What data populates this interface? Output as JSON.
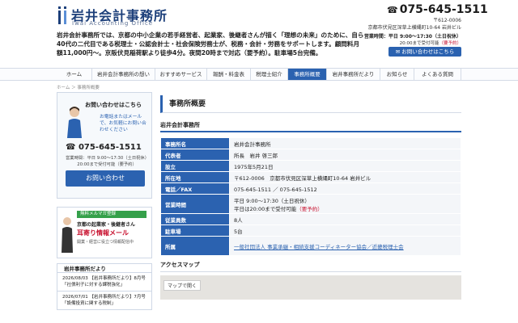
{
  "header": {
    "logo_title": "岩井会計事務所",
    "logo_sub": "Iwai Accounting Office",
    "intro": "岩井会計事務所では、京都の中小企業の若手経営者、起業家、後継者さんが描く「理想の未来」のために、自ら40代の二代目である税理士・公認会計士・社会保険労務士が、税務・会計・労務をサポートします。顧問料月額11,000円～。京阪伏見稲荷駅より徒歩4分。夜間20時まで対応（要予約）。駐車場5台完備。",
    "phone": "075-645-1511",
    "addr1": "〒612-0006",
    "addr2": "京都市伏見区深草上横縄町10-64 岩井ビル",
    "hours": "営業時間：平日 9:00～17:30（土日祝休）",
    "hours_note": "20:00まで受付可能",
    "hours_req": "（要予約）",
    "contact_btn": "お問い合わせはこちら"
  },
  "nav": [
    "ホーム",
    "岩井会計事務所の想い",
    "おすすめサービス",
    "報酬・料金表",
    "税理士紹介",
    "事務所概要",
    "岩井事務所だより",
    "お知らせ",
    "よくある質問"
  ],
  "breadcrumb": "ホーム ＞ 事務所概要",
  "sidebar": {
    "contact_title": "お問い合わせはこちら",
    "contact_note": "お電話またはメールで、お気軽にお問い合わせください",
    "phone": "075-645-1511",
    "hours": "営業時間：平日 9:00～17:30（土日祝休）",
    "hours_note": "20:00まで受付可能（要予約）",
    "button": "お問い合わせ",
    "mail_head": "無料メルマガ登録",
    "mail_l1": "京都の起業家・後継者さん",
    "mail_l2": "耳寄り情報メール",
    "mail_l3": "開業・経営に役立つ情報配信中",
    "news_title": "岩井事務所だより",
    "news": [
      "2026/08/03 【岩井事務所だより】8月号「社債利子に対する課税強化」",
      "2026/07/01 【岩井事務所だより】7月号「設備投資に関する税制」"
    ]
  },
  "main": {
    "title": "事務所概要",
    "subtitle": "岩井会計事務所",
    "rows": [
      {
        "k": "事務所名",
        "v": "岩井会計事務所"
      },
      {
        "k": "代表者",
        "v": "所長　岩井 啓三郎"
      },
      {
        "k": "設立",
        "v": "1975年5月21日"
      },
      {
        "k": "所在地",
        "v": "〒612-0006　京都市伏見区深草上横縄町10-64 岩井ビル"
      },
      {
        "k": "電話／FAX",
        "v": "075-645-1511 ／ 075-645-1512"
      },
      {
        "k": "営業時間",
        "v": "平日 9:00～17:30（土日祝休）"
      },
      {
        "k": "従業員数",
        "v": "8人"
      },
      {
        "k": "駐車場",
        "v": "5台"
      },
      {
        "k": "所属",
        "v": "一般社団法人 事業承継・相続支援コーディネーター協会／近畿税理士会"
      }
    ],
    "hours_extra": "平日は20:00まで受付可能",
    "hours_req": "（要予約）",
    "map_title": "アクセスマップ",
    "map_link": "マップで開く"
  },
  "colors": {
    "accent": "#2b62b0",
    "alert": "#c8102e",
    "green": "#35a04a"
  }
}
